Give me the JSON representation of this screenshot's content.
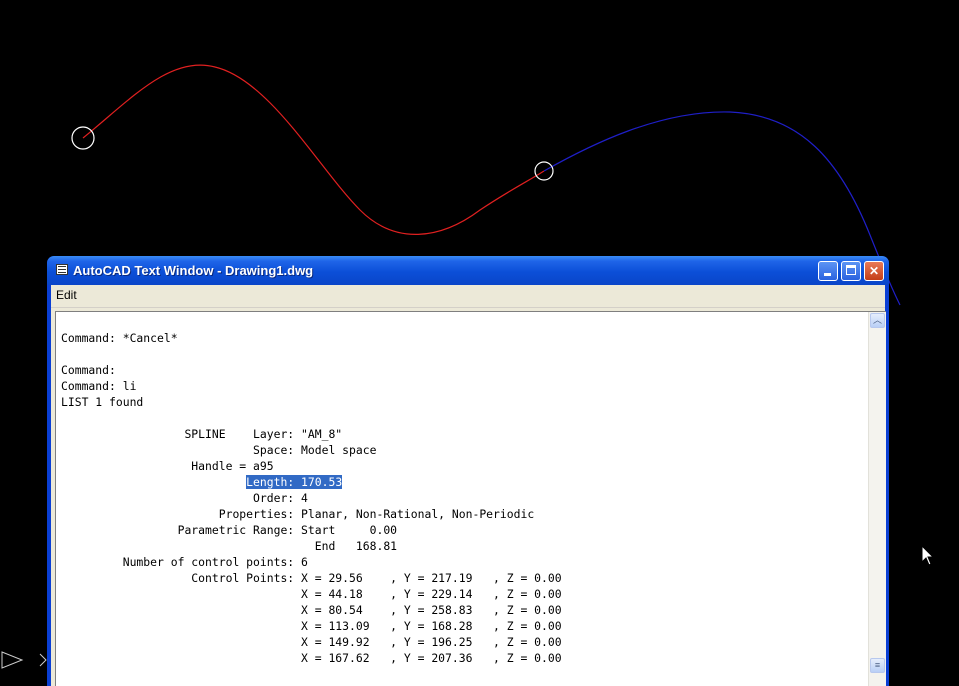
{
  "drawing": {
    "colors": {
      "background": "#000000",
      "spline_left": "#e02020",
      "spline_right": "#1f1fc8",
      "grip": "#ffffff"
    }
  },
  "window": {
    "title": "AutoCAD Text Window - Drawing1.dwg",
    "menu": [
      "Edit"
    ],
    "buttons": {
      "minimize": "minimize",
      "maximize": "maximize",
      "close": "close"
    },
    "colors": {
      "titlebar": "#0a4fd8",
      "selection": "#316ac5"
    }
  },
  "console": {
    "lines": [
      "Command: *Cancel*",
      "",
      "Command:",
      "Command: li",
      "LIST 1 found",
      "",
      "                  SPLINE    Layer: \"AM_8\"",
      "                            Space: Model space",
      "                   Handle = a95",
      "                           Length: 170.53",
      "                            Order: 4",
      "                       Properties: Planar, Non-Rational, Non-Periodic",
      "                 Parametric Range: Start     0.00",
      "                                     End   168.81",
      "         Number of control points: 6",
      "                   Control Points: X = 29.56    , Y = 217.19   , Z = 0.00",
      "                                   X = 44.18    , Y = 229.14   , Z = 0.00",
      "                                   X = 80.54    , Y = 258.83   , Z = 0.00",
      "                                   X = 113.09   , Y = 168.28   , Z = 0.00",
      "                                   X = 149.92   , Y = 196.25   , Z = 0.00",
      "                                   X = 167.62   , Y = 207.36   , Z = 0.00"
    ],
    "highlight": {
      "line_index": 9,
      "text": "Length: 170.53"
    }
  }
}
